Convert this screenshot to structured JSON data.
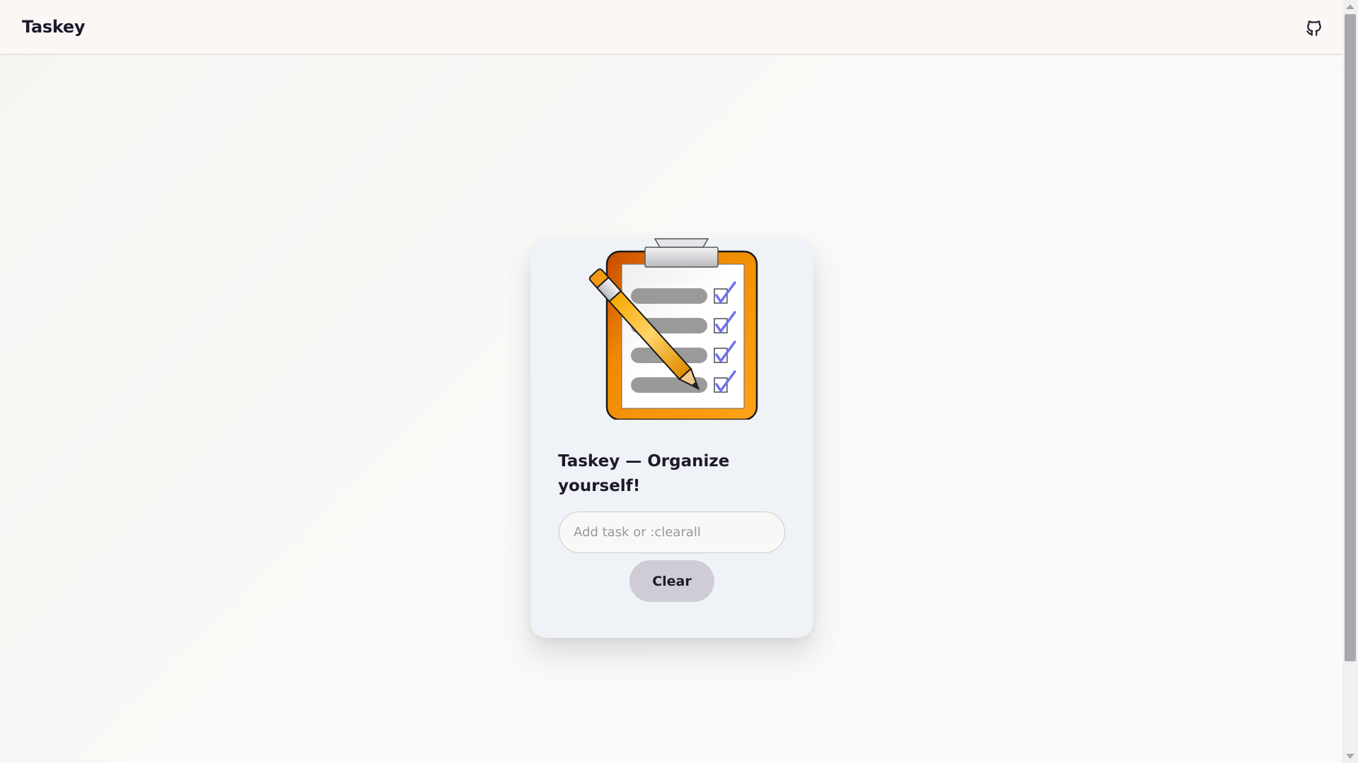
{
  "header": {
    "brand": "Taskey",
    "github_icon": "github-icon"
  },
  "card": {
    "illustration_icon": "clipboard-checklist-pencil-illustration",
    "title": "Taskey — Organize yourself!",
    "input": {
      "placeholder": "Add task or :clearall",
      "value": ""
    },
    "clear_button": "Clear"
  },
  "colors": {
    "page_bg": "#faf8f6",
    "card_bg": "#eff2f7",
    "text": "#1e1a2a",
    "button_bg": "#cfccd6",
    "clipboard_orange": "#f59a0a",
    "check_blue": "#6f6ff0"
  }
}
